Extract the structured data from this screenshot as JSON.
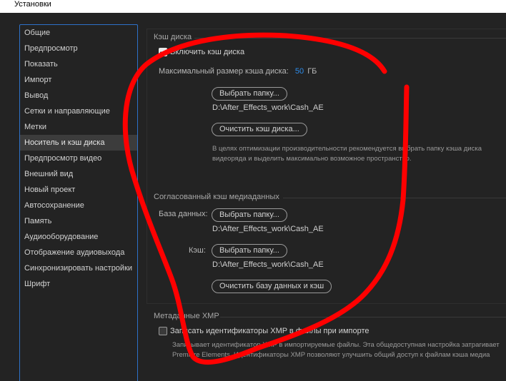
{
  "window": {
    "title": "Установки"
  },
  "sidebar": {
    "items": [
      {
        "label": "Общие"
      },
      {
        "label": "Предпросмотр"
      },
      {
        "label": "Показать"
      },
      {
        "label": "Импорт"
      },
      {
        "label": "Вывод"
      },
      {
        "label": "Сетки и направляющие"
      },
      {
        "label": "Метки"
      },
      {
        "label": "Носитель и кэш диска",
        "active": true
      },
      {
        "label": "Предпросмотр видео"
      },
      {
        "label": "Внешний вид"
      },
      {
        "label": "Новый проект"
      },
      {
        "label": "Автосохранение"
      },
      {
        "label": "Память"
      },
      {
        "label": "Аудиооборудование"
      },
      {
        "label": "Отображение аудиовыхода"
      },
      {
        "label": "Синхронизировать настройки"
      },
      {
        "label": "Шрифт"
      }
    ]
  },
  "disk_cache": {
    "section_title": "Кэш диска",
    "enable_label": "Включить кэш диска",
    "enable_checked": true,
    "max_size_label": "Максимальный размер кэша диска:",
    "max_size_value": "50",
    "max_size_unit": "ГБ",
    "choose_folder_button": "Выбрать папку...",
    "folder_path": "D:\\After_Effects_work\\Cash_AE",
    "clear_button": "Очистить кэш диска...",
    "note_line1": "В целях оптимизации производительности рекомендуется выбрать папку кэша диска",
    "note_line2": "видеоряда и выделить максимально возможное пространство."
  },
  "media_cache": {
    "section_title": "Согласованный кэш медиаданных",
    "database_label": "База данных:",
    "database_button": "Выбрать папку...",
    "database_path": "D:\\After_Effects_work\\Cash_AE",
    "cache_label": "Кэш:",
    "cache_button": "Выбрать папку...",
    "cache_path": "D:\\After_Effects_work\\Cash_AE",
    "clear_button": "Очистить базу данных и кэш"
  },
  "xmp": {
    "section_title": "Метаданные XMP",
    "write_label": "Записать идентификаторы XMP в файлы при импорте",
    "write_checked": false,
    "note_line1": "Записывает идентификатор XMP в импортируемые файлы. Эта общедоступная настройка затрагивает",
    "note_line2": "Premiere Elements. Идентификаторы XMP позволяют улучшить общий доступ к файлам кэша медиа"
  },
  "colors": {
    "accent": "#2d8ceb",
    "annotation": "#ff0000",
    "background": "#232323"
  }
}
